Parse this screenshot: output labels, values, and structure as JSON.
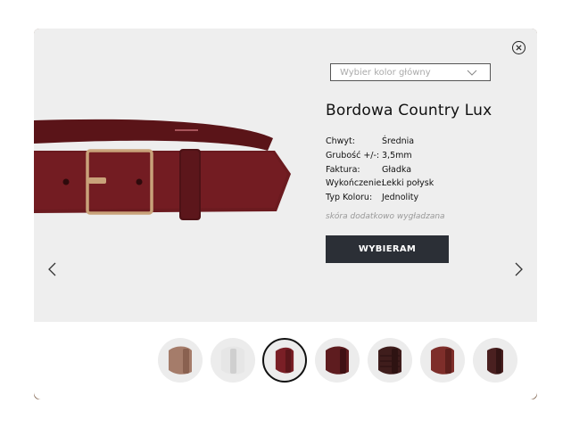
{
  "modal": {
    "color_select": {
      "placeholder": "Wybier kolor główny"
    },
    "product": {
      "title": "Bordowa Country Lux",
      "specs": [
        {
          "label": "Chwyt:",
          "value": "Średnia"
        },
        {
          "label": "Grubość +/-:",
          "value": "3,5mm"
        },
        {
          "label": "Faktura:",
          "value": "Gładka"
        },
        {
          "label": "Wykończenie:",
          "value": "Lekki połysk"
        },
        {
          "label": "Typ Koloru:",
          "value": "Jednolity"
        }
      ],
      "note": "skóra dodatkowo wygładzana",
      "choose_label": "WYBIERAM"
    },
    "icons": {
      "close": "close-icon",
      "select_arrow": "chevron-down-icon",
      "prev": "chevron-left-icon",
      "next": "chevron-right-icon"
    },
    "colors": {
      "background": "#eeeeee",
      "button": "#2b2f36",
      "belt": "#6b1a1f",
      "buckle": "#c9a27a"
    },
    "thumbnails": [
      {
        "name": "beige",
        "color": "#a57c6a",
        "selected": false
      },
      {
        "name": "white",
        "color": "#e6e6e6",
        "selected": false
      },
      {
        "name": "burgundy",
        "color": "#7a1f26",
        "selected": true
      },
      {
        "name": "dark-burgundy",
        "color": "#5e1c1f",
        "selected": false
      },
      {
        "name": "croc-brown",
        "color": "#3f1d1c",
        "selected": false
      },
      {
        "name": "brick",
        "color": "#7e2e2a",
        "selected": false
      },
      {
        "name": "dark-brown",
        "color": "#4a2020",
        "selected": false
      }
    ]
  }
}
